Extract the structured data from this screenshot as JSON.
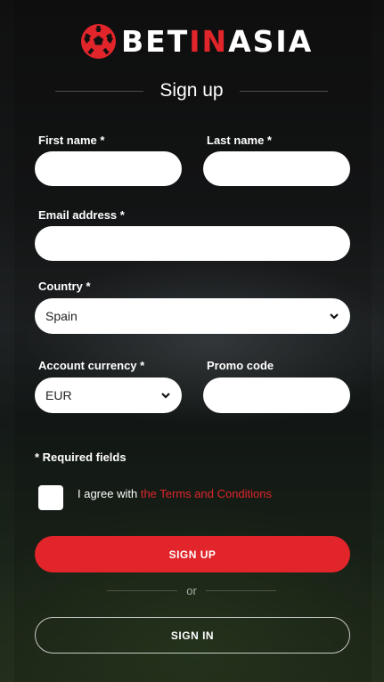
{
  "brand": {
    "part1": "BET",
    "part2": "IN",
    "part3": "ASIA",
    "accent": "#e1252b"
  },
  "form": {
    "title": "Sign up",
    "first_name_label": "First name *",
    "last_name_label": "Last name *",
    "email_label": "Email address *",
    "country_label": "Country *",
    "country_value": "Spain",
    "currency_label": "Account currency *",
    "currency_value": "EUR",
    "promo_label": "Promo code",
    "required_note": "* Required fields",
    "agree_text": "I agree with ",
    "terms_link": "the Terms and Conditions",
    "signup_button": "SIGN UP",
    "or_text": "or",
    "signin_button": "SIGN IN"
  },
  "icons": {
    "logo": "soccer-ball-icon",
    "select_arrow": "chevron-down-icon"
  }
}
